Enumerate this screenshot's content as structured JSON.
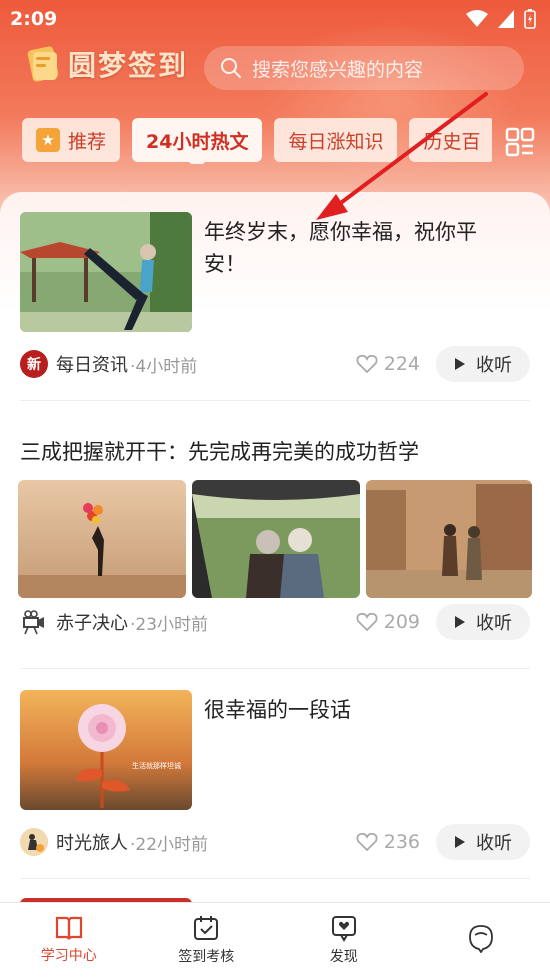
{
  "status_bar": {
    "time": "2:09"
  },
  "app": {
    "title": "圆梦签到"
  },
  "search": {
    "placeholder": "搜索您感兴趣的内容"
  },
  "tabs": [
    {
      "label": "推荐",
      "active": false
    },
    {
      "label": "24小时热文",
      "active": true
    },
    {
      "label": "每日涨知识",
      "active": false
    },
    {
      "label": "历史百",
      "active": false
    }
  ],
  "articles": [
    {
      "title": "年终岁末，愿你幸福，祝你平安！",
      "source": "每日资讯",
      "time": "·4小时前",
      "likes": "224",
      "listen_label": "收听",
      "avatar_text": "新"
    },
    {
      "title": "三成把握就开干：先完成再完美的成功哲学",
      "source": "赤子决心",
      "time": "·23小时前",
      "likes": "209",
      "listen_label": "收听"
    },
    {
      "title": "很幸福的一段话",
      "source": "时光旅人",
      "time": "·22小时前",
      "likes": "236",
      "listen_label": "收听",
      "image_caption": "生活就那样坦诚"
    }
  ],
  "bottom_nav": [
    {
      "label": "学习中心",
      "active": true,
      "icon": "book-icon"
    },
    {
      "label": "签到考核",
      "active": false,
      "icon": "calendar-check-icon"
    },
    {
      "label": "发现",
      "active": false,
      "icon": "discover-chat-icon"
    },
    {
      "label": "",
      "active": false,
      "icon": "profile-icon"
    }
  ],
  "colors": {
    "accent": "#e0452e",
    "header": "#ee5a3c",
    "arrow": "#e02020"
  }
}
